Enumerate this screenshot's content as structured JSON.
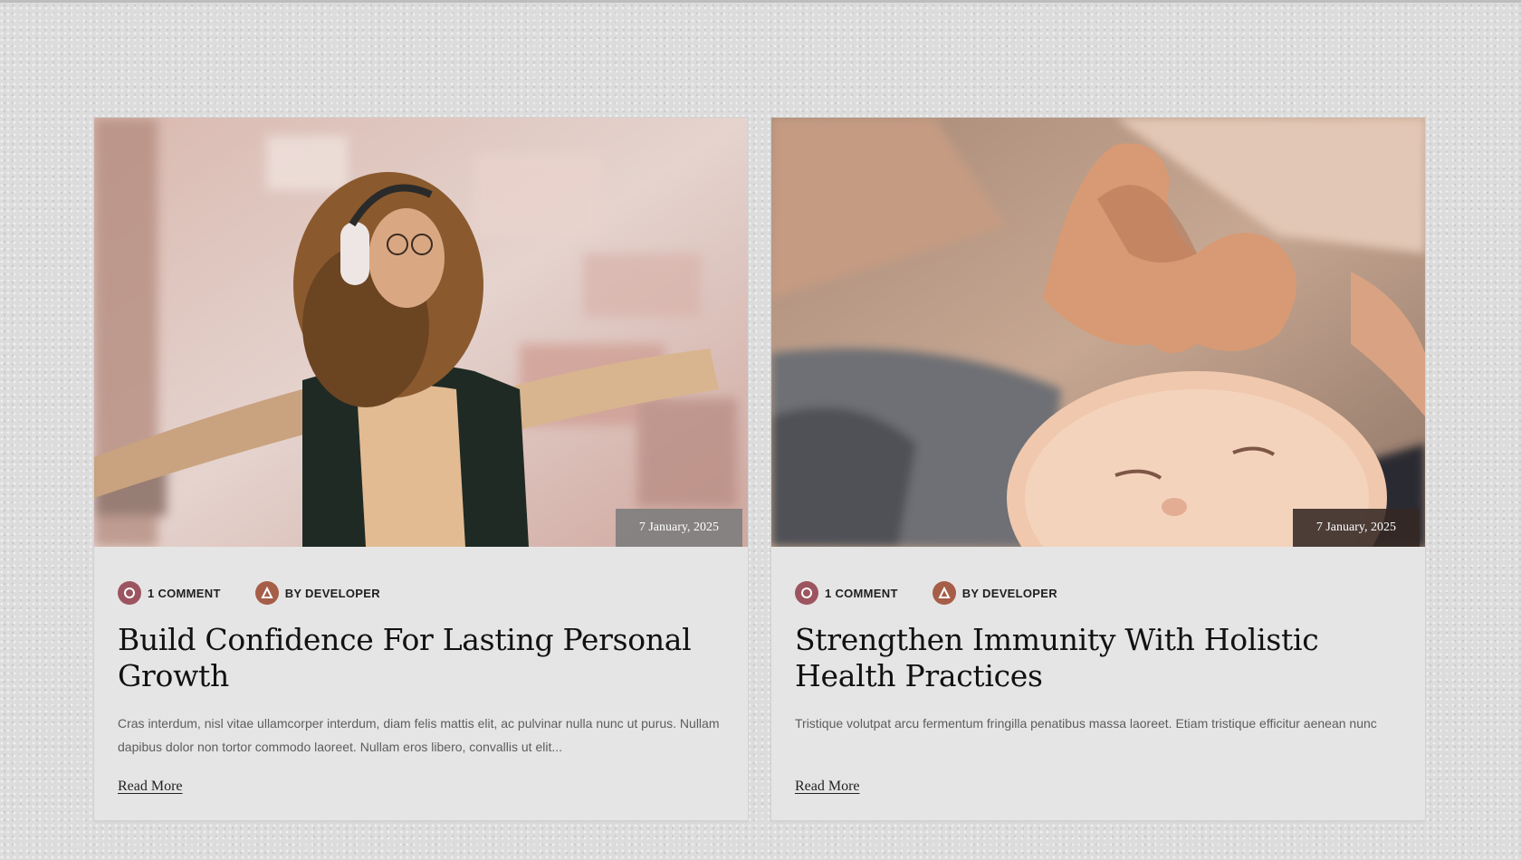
{
  "posts": [
    {
      "date": "7 January, 2025",
      "comments": "1 COMMENT",
      "author": "BY DEVELOPER",
      "title": "Build Confidence For Lasting Personal Growth",
      "excerpt": "Cras interdum, nisl vitae ullamcorper interdum, diam felis mattis elit, ac pulvinar nulla nunc ut purus. Nullam dapibus dolor non tortor commodo laoreet. Nullam eros libero, convallis ut elit...",
      "read_more": "Read More"
    },
    {
      "date": "7 January, 2025",
      "comments": "1 COMMENT",
      "author": "BY DEVELOPER",
      "title": "Strengthen Immunity With Holistic Health Practices",
      "excerpt": "Tristique volutpat arcu fermentum fringilla penatibus massa laoreet. Etiam tristique efficitur aenean nunc",
      "read_more": "Read More"
    }
  ],
  "icons": {
    "comment": "comment-icon",
    "author": "user-icon"
  },
  "colors": {
    "comment_icon": "#9c5560",
    "author_icon": "#a65e49",
    "card_background": "#e6e5e5"
  }
}
